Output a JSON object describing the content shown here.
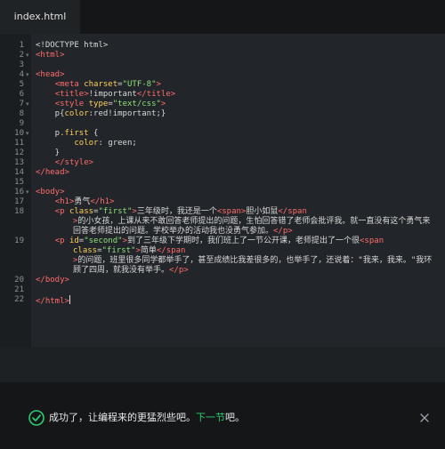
{
  "editor": {
    "tab_label": "index.html",
    "lines": [
      {
        "n": "1",
        "fold": "",
        "tokens": [
          {
            "t": "<!DOCTYPE html>",
            "c": "kw"
          }
        ]
      },
      {
        "n": "2",
        "fold": "▾",
        "tokens": [
          {
            "t": "<html>",
            "c": "tag"
          }
        ]
      },
      {
        "n": "3",
        "fold": "",
        "tokens": []
      },
      {
        "n": "4",
        "fold": "▾",
        "tokens": [
          {
            "t": "<head>",
            "c": "tag"
          }
        ]
      },
      {
        "n": "5",
        "fold": "",
        "tokens": [
          {
            "t": "    "
          },
          {
            "t": "<meta ",
            "c": "tag"
          },
          {
            "t": "charset",
            "c": "attr"
          },
          {
            "t": "=",
            "c": "punc"
          },
          {
            "t": "\"UTF-8\"",
            "c": "str"
          },
          {
            "t": ">",
            "c": "tag"
          }
        ]
      },
      {
        "n": "6",
        "fold": "",
        "tokens": [
          {
            "t": "    "
          },
          {
            "t": "<title>",
            "c": "tag"
          },
          {
            "t": "!important",
            "c": "kw"
          },
          {
            "t": "</title>",
            "c": "tag"
          }
        ]
      },
      {
        "n": "7",
        "fold": "▾",
        "tokens": [
          {
            "t": "    "
          },
          {
            "t": "<style ",
            "c": "tag"
          },
          {
            "t": "type",
            "c": "attr"
          },
          {
            "t": "=",
            "c": "punc"
          },
          {
            "t": "\"text/css\"",
            "c": "str"
          },
          {
            "t": ">",
            "c": "tag"
          }
        ]
      },
      {
        "n": "8",
        "fold": "",
        "tokens": [
          {
            "t": "    p{",
            "c": "kw"
          },
          {
            "t": "color",
            "c": "prop"
          },
          {
            "t": ":red!important;}",
            "c": "kw"
          }
        ]
      },
      {
        "n": "9",
        "fold": "",
        "tokens": []
      },
      {
        "n": "10",
        "fold": "▾",
        "tokens": [
          {
            "t": "    p",
            "c": "kw"
          },
          {
            "t": ".first",
            "c": "attr"
          },
          {
            "t": " {",
            "c": "kw"
          }
        ]
      },
      {
        "n": "11",
        "fold": "",
        "tokens": [
          {
            "t": "        "
          },
          {
            "t": "color",
            "c": "prop"
          },
          {
            "t": ": green;",
            "c": "kw"
          }
        ]
      },
      {
        "n": "12",
        "fold": "",
        "tokens": [
          {
            "t": "    }",
            "c": "kw"
          }
        ]
      },
      {
        "n": "13",
        "fold": "",
        "tokens": [
          {
            "t": "    "
          },
          {
            "t": "</style>",
            "c": "tag"
          }
        ]
      },
      {
        "n": "14",
        "fold": "",
        "tokens": [
          {
            "t": "</head>",
            "c": "tag"
          }
        ]
      },
      {
        "n": "15",
        "fold": "",
        "tokens": []
      },
      {
        "n": "16",
        "fold": "▾",
        "tokens": [
          {
            "t": "<body>",
            "c": "tag"
          }
        ]
      },
      {
        "n": "17",
        "fold": "",
        "tokens": [
          {
            "t": "    "
          },
          {
            "t": "<h1>",
            "c": "tag"
          },
          {
            "t": "勇气",
            "c": "kw"
          },
          {
            "t": "</h1>",
            "c": "tag"
          }
        ]
      },
      {
        "n": "18",
        "fold": "",
        "tokens": [
          {
            "t": "    "
          },
          {
            "t": "<p ",
            "c": "tag"
          },
          {
            "t": "class",
            "c": "attr"
          },
          {
            "t": "=",
            "c": "punc"
          },
          {
            "t": "\"first\"",
            "c": "str"
          },
          {
            "t": ">",
            "c": "tag"
          },
          {
            "t": "三年级时，我还是一个",
            "c": "kw"
          },
          {
            "t": "<span>",
            "c": "tag"
          },
          {
            "t": "胆小如鼠",
            "c": "kw"
          },
          {
            "t": "</span",
            "c": "tag"
          }
        ]
      },
      {
        "n": "",
        "fold": "",
        "wrap": true,
        "tokens": [
          {
            "t": ">",
            "c": "tag"
          },
          {
            "t": "的小女孩，上课从来不敢回答老师提出的问题，生怕回答错了老师会批评我。就一直没有这个勇气来回答老师提出的问题。学校举办的活动我也没勇气参加。",
            "c": "kw"
          },
          {
            "t": "</p>",
            "c": "tag"
          }
        ]
      },
      {
        "n": "19",
        "fold": "",
        "tokens": [
          {
            "t": "    "
          },
          {
            "t": "<p ",
            "c": "tag"
          },
          {
            "t": "id",
            "c": "attr"
          },
          {
            "t": "=",
            "c": "punc"
          },
          {
            "t": "\"second\"",
            "c": "str"
          },
          {
            "t": ">",
            "c": "tag"
          },
          {
            "t": "到了三年级下学期时，我们班上了一节公开课，老师提出了一个很",
            "c": "kw"
          },
          {
            "t": "<span",
            "c": "tag"
          }
        ]
      },
      {
        "n": "",
        "fold": "",
        "wrap": true,
        "tokens": [
          {
            "t": "class",
            "c": "attr"
          },
          {
            "t": "=",
            "c": "punc"
          },
          {
            "t": "\"first\"",
            "c": "str"
          },
          {
            "t": ">",
            "c": "tag"
          },
          {
            "t": "简单",
            "c": "kw"
          },
          {
            "t": "</span",
            "c": "tag"
          }
        ]
      },
      {
        "n": "",
        "fold": "",
        "wrap": true,
        "tokens": [
          {
            "t": ">",
            "c": "tag"
          },
          {
            "t": "的问题，班里很多同学都举手了，甚至成绩比我差很多的，也举手了，还说着：\"我来，我来。\"我环顾了四周，就我没有举手。",
            "c": "kw"
          },
          {
            "t": "</p>",
            "c": "tag"
          }
        ]
      },
      {
        "n": "20",
        "fold": "",
        "tokens": [
          {
            "t": "</body>",
            "c": "tag"
          }
        ]
      },
      {
        "n": "21",
        "fold": "",
        "tokens": []
      },
      {
        "n": "22",
        "fold": "",
        "tokens": [
          {
            "t": "</html>",
            "c": "tag"
          }
        ],
        "cursor": true
      }
    ]
  },
  "toast": {
    "message_prefix": "成功了，让编程来的更猛烈些吧。",
    "next_link": "下一节",
    "message_suffix": "吧。",
    "check_icon_color": "#2ecc71",
    "link_color": "#2ecc71"
  },
  "colors": {
    "tag": "#ff6b6b",
    "attribute": "#ffcf5a",
    "string": "#8ee07a",
    "background": "#22262a"
  }
}
